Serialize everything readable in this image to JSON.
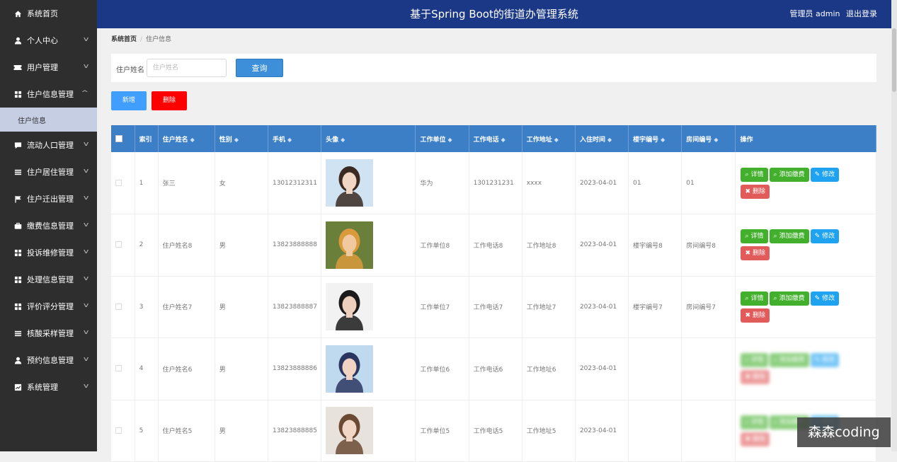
{
  "sidebar": {
    "items": [
      {
        "label": "系统首页",
        "icon": "home-icon",
        "chevron": false
      },
      {
        "label": "个人中心",
        "icon": "user-icon",
        "chevron": true
      },
      {
        "label": "用户管理",
        "icon": "ticket-icon",
        "chevron": true
      },
      {
        "label": "住户信息管理",
        "icon": "grid-icon",
        "chevron": true,
        "expanded": true
      },
      {
        "label": "流动人口管理",
        "icon": "comment-icon",
        "chevron": true
      },
      {
        "label": "住户居住管理",
        "icon": "list-icon",
        "chevron": true
      },
      {
        "label": "住户迁出管理",
        "icon": "flag-icon",
        "chevron": true
      },
      {
        "label": "缴费信息管理",
        "icon": "briefcase-icon",
        "chevron": true
      },
      {
        "label": "投诉维修管理",
        "icon": "grid-icon",
        "chevron": true
      },
      {
        "label": "处理信息管理",
        "icon": "grid-icon",
        "chevron": true
      },
      {
        "label": "评价评分管理",
        "icon": "grid-icon",
        "chevron": true
      },
      {
        "label": "核酸采样管理",
        "icon": "list-icon",
        "chevron": true
      },
      {
        "label": "预约信息管理",
        "icon": "user-icon",
        "chevron": true
      },
      {
        "label": "系统管理",
        "icon": "chart-icon",
        "chevron": true
      }
    ],
    "sub_item": "住户信息"
  },
  "header": {
    "title": "基于Spring Boot的街道办管理系统",
    "user": "管理员 admin",
    "logout": "退出登录"
  },
  "breadcrumb": {
    "home": "系统首页",
    "current": "住户信息"
  },
  "search": {
    "label": "住户姓名",
    "placeholder": "住户姓名",
    "button": "查询"
  },
  "toolbar": {
    "add": "新增",
    "delete": "删除"
  },
  "table": {
    "columns": [
      "索引",
      "住户姓名",
      "性别",
      "手机",
      "头像",
      "工作单位",
      "工作电话",
      "工作地址",
      "入住时间",
      "楼宇编号",
      "房间编号",
      "操作"
    ],
    "actions": {
      "detail": "详情",
      "pay": "添加缴费",
      "edit": "修改",
      "delete": "删除"
    },
    "rows": [
      {
        "index": "1",
        "name": "张三",
        "gender": "女",
        "phone": "13012312311",
        "company": "华为",
        "work_phone": "1301231231",
        "address": "xxxx",
        "date": "2023-04-01",
        "building": "01",
        "room": "01"
      },
      {
        "index": "2",
        "name": "住户姓名8",
        "gender": "男",
        "phone": "13823888888",
        "company": "工作单位8",
        "work_phone": "工作电话8",
        "address": "工作地址8",
        "date": "2023-04-01",
        "building": "楼宇编号8",
        "room": "房间编号8"
      },
      {
        "index": "3",
        "name": "住户姓名7",
        "gender": "男",
        "phone": "13823888887",
        "company": "工作单位7",
        "work_phone": "工作电话7",
        "address": "工作地址7",
        "date": "2023-04-01",
        "building": "楼宇编号7",
        "room": "房间编号7"
      },
      {
        "index": "4",
        "name": "住户姓名6",
        "gender": "男",
        "phone": "13823888886",
        "company": "工作单位6",
        "work_phone": "工作电话6",
        "address": "工作地址6",
        "date": "2023-04-01",
        "building": "",
        "room": ""
      },
      {
        "index": "5",
        "name": "住户姓名5",
        "gender": "男",
        "phone": "13823888885",
        "company": "工作单位5",
        "work_phone": "工作电话5",
        "address": "工作地址5",
        "date": "2023-04-01",
        "building": "",
        "room": ""
      }
    ]
  },
  "watermark": "森森coding",
  "colors": {
    "header": "#1b3886",
    "sidebar": "#2e2e2e",
    "table_header": "#3c7fc6",
    "green": "#42b02c",
    "blue": "#1fa3f1",
    "red": "#e25b5b"
  }
}
